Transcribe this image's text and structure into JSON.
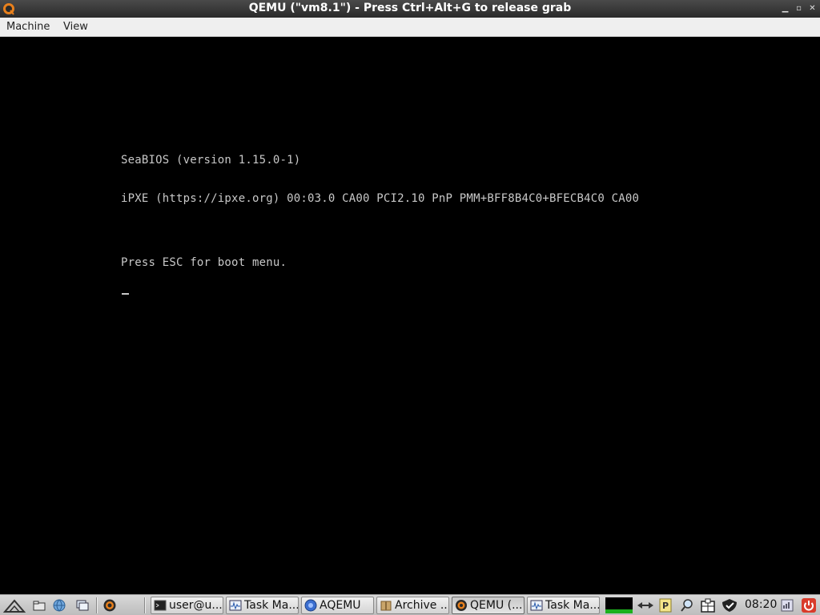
{
  "window": {
    "title": "QEMU (\"vm8.1\") - Press Ctrl+Alt+G to release grab",
    "app_icon": "qemu-icon",
    "controls": [
      "minimize-icon",
      "maximize-icon",
      "close-icon"
    ]
  },
  "menubar": {
    "items": [
      "Machine",
      "View"
    ]
  },
  "console": {
    "lines": [
      "SeaBIOS (version 1.15.0-1)",
      "iPXE (https://ipxe.org) 00:03.0 CA00 PCI2.10 PnP PMM+BFF8B4C0+BFECB4C0 CA00",
      "Press ESC for boot menu."
    ],
    "cursor": "_"
  },
  "taskbar": {
    "launchers": [
      "start-menu-icon",
      "file-manager-icon",
      "web-browser-icon",
      "show-desktop-icon",
      "qemu-launcher-icon"
    ],
    "tasks": [
      {
        "label": "user@u...",
        "icon": "terminal-icon"
      },
      {
        "label": "Task Ma...",
        "icon": "task-manager-icon"
      },
      {
        "label": "AQEMU",
        "icon": "aqemu-icon"
      },
      {
        "label": "Archive ...",
        "icon": "archive-icon"
      },
      {
        "label": "QEMU (...",
        "icon": "qemu-icon"
      },
      {
        "label": "Task Ma...",
        "icon": "task-manager-icon"
      }
    ],
    "tray": [
      "cpu-monitor-icon",
      "network-icon",
      "parcellite-icon",
      "search-icon",
      "clipboard-icon",
      "vpn-shield-icon",
      "volume-icon",
      "power-icon"
    ],
    "clock": "08:20"
  },
  "colors": {
    "console_text": "#c8c8c8",
    "screen_bg": "#000000",
    "titlebar": "#333333",
    "menubar": "#efefef",
    "taskbar": "#cccccc"
  }
}
